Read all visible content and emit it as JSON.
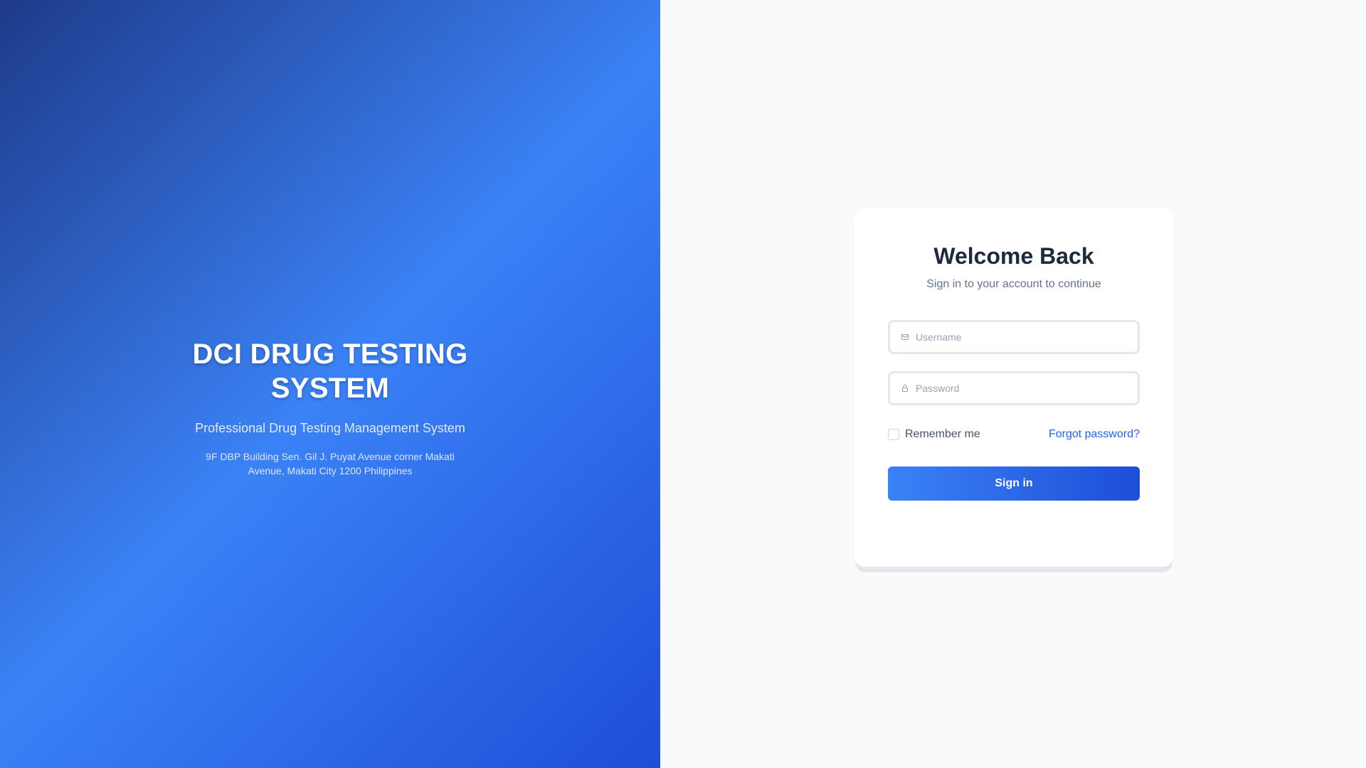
{
  "brand": {
    "title": "DCI DRUG TESTING SYSTEM",
    "subtitle": "Professional Drug Testing Management System",
    "address": "9F DBP Building Sen. Gil J. Puyat Avenue corner Makati Avenue, Makati City 1200 Philippines"
  },
  "login": {
    "title": "Welcome Back",
    "subtitle": "Sign in to your account to continue",
    "username": {
      "placeholder": "Username",
      "value": "",
      "icon": "mail-icon"
    },
    "password": {
      "placeholder": "Password",
      "value": "",
      "icon": "lock-icon"
    },
    "remember_label": "Remember me",
    "remember_checked": false,
    "forgot_label": "Forgot password?",
    "signin_label": "Sign in"
  },
  "colors": {
    "brand_gradient": [
      "#1e3a8a",
      "#3b82f6",
      "#1d4ed8"
    ],
    "accent": "#2563eb",
    "title_text": "#1e293b",
    "page_background": "#f8fafc"
  }
}
